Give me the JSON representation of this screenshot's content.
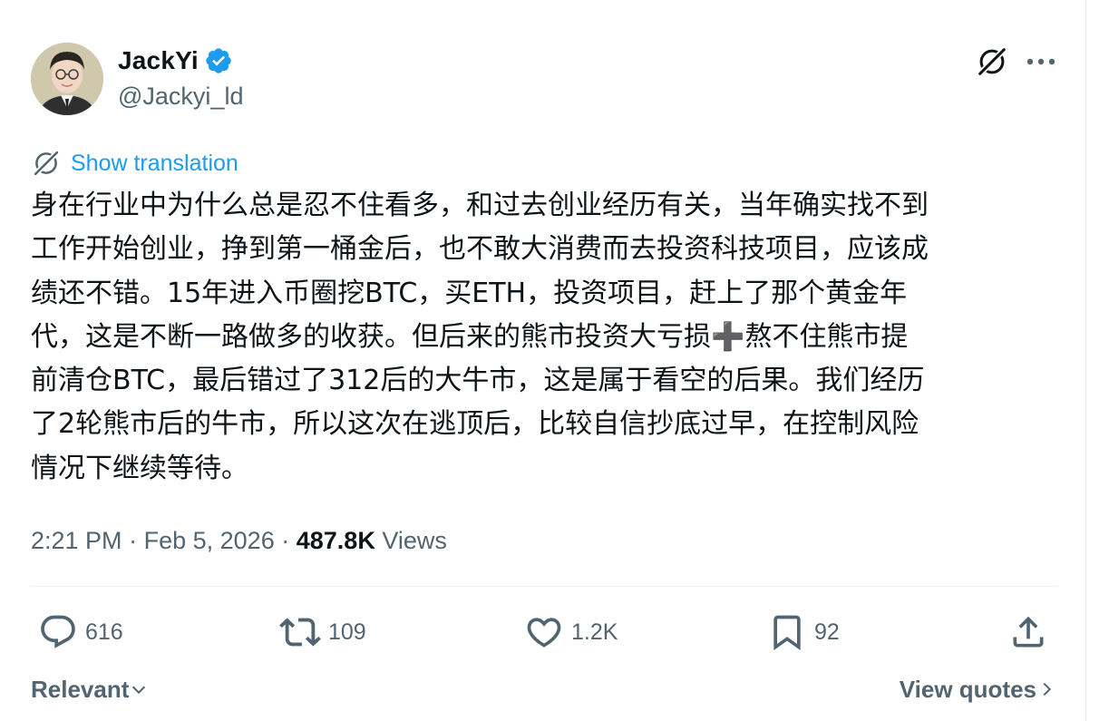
{
  "author": {
    "name": "JackYi",
    "handle": "@Jackyi_ld",
    "verified": true
  },
  "icons": {
    "verified": "verified-badge-icon",
    "grok": "grok-icon",
    "more": "more-dots-icon",
    "translate": "grok-icon",
    "reply": "reply-icon",
    "retweet": "retweet-icon",
    "like": "heart-icon",
    "bookmark": "bookmark-icon",
    "share": "share-icon"
  },
  "colors": {
    "accent": "#1d9bf0",
    "text": "#0f1419",
    "muted": "#536471"
  },
  "translate_label": "Show translation",
  "tweet": {
    "text": "身在行业中为什么总是忍不住看多，和过去创业经历有关，当年确实找不到\n工作开始创业，挣到第一桶金后，也不敢大消费而去投资科技项目，应该成\n绩还不错。15年进入币圈挖BTC，买ETH，投资项目，赶上了那个黄金年\n代，这是不断一路做多的收获。但后来的熊市投资大亏损➕熬不住熊市提\n前清仓BTC，最后错过了312后的大牛市，这是属于看空的后果。我们经历\n了2轮熊市后的牛市，所以这次在逃顶后，比较自信抄底过早，在控制风险\n情况下继续等待。"
  },
  "meta": {
    "time": "2:21 PM",
    "separator": "·",
    "date": "Feb 5, 2026",
    "views_count": "487.8K",
    "views_label": "Views"
  },
  "actions": {
    "replies": "616",
    "retweets": "109",
    "likes": "1.2K",
    "bookmarks": "92"
  },
  "footer": {
    "sort_label": "Relevant",
    "quotes_label": "View quotes"
  }
}
